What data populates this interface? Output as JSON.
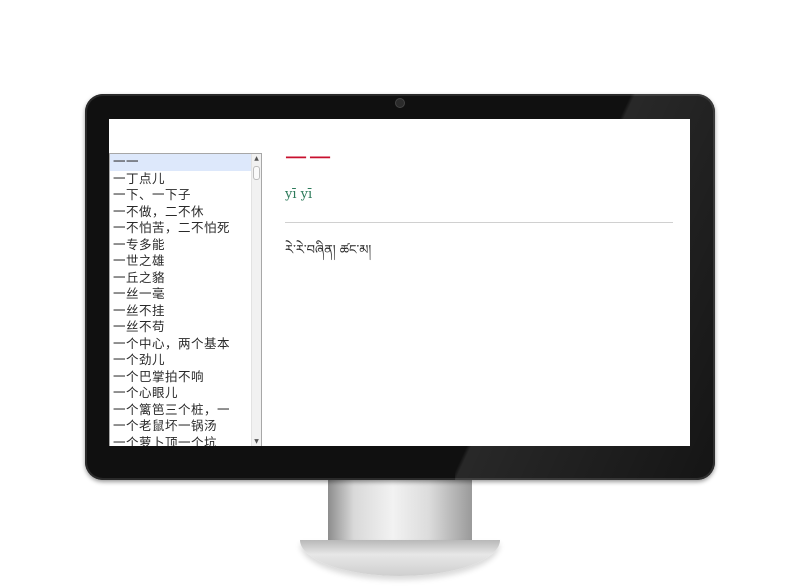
{
  "list": {
    "items": [
      "一一",
      "一丁点儿",
      "一下、一下子",
      "一不做，二不休",
      "一不怕苦，二不怕死",
      "一专多能",
      "一世之雄",
      "一丘之貉",
      "一丝一毫",
      "一丝不挂",
      "一丝不苟",
      "一个中心，两个基本",
      "一个劲儿",
      "一个巴掌拍不响",
      "一个心眼儿",
      "一个篱笆三个桩，一",
      "一个老鼠坏一锅汤",
      "一个萝卜顶一个坑"
    ],
    "selected_index": 0
  },
  "entry": {
    "headword": "一一",
    "pinyin": "yī yī",
    "translation": "རེ་རེ་བཞིན། ཚང་མ།"
  },
  "scrollbar": {
    "up_arrow": "▲",
    "down_arrow": "▼"
  },
  "device": {
    "logo_icon": "apple-logo-icon",
    "logo_glyph": ""
  }
}
